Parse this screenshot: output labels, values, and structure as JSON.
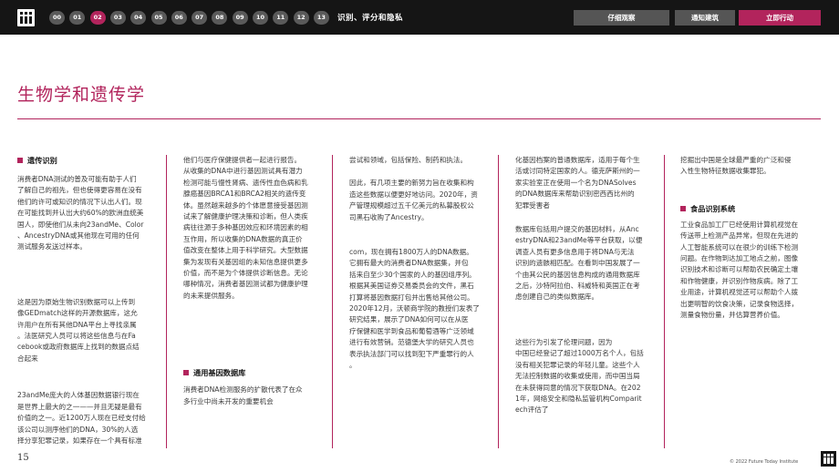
{
  "header": {
    "chapters": [
      "00",
      "01",
      "02",
      "03",
      "04",
      "05",
      "06",
      "07",
      "08",
      "09",
      "10",
      "11",
      "12",
      "13"
    ],
    "active_chapter": "02",
    "section_label": "识别、评分和隐私",
    "tabs": {
      "observe": "仔细观察",
      "notice": "通知建筑",
      "act": "立即行动"
    },
    "accent_color": "#b2245c"
  },
  "title": "生物学和遗传学",
  "col1": {
    "heading": "遗传识别",
    "p1": [
      "消费者DNA测试的普及可能有助于人们",
      "了解自己的祖先，但也使得更容易在没有",
      "他们的许可或知识的情况下认出人们。现",
      "在可能找到并认出大约60%的欧洲血统美",
      "国人，即使他们从未向23andMe、Color",
      "、AncestryDNA或其他现在可用的任何",
      "测试服务发送过样本。"
    ],
    "p2": [
      "这是因为原始生物识别数据可以上传到",
      "像GEDmatch这样的开源数据库，这允",
      "许用户在所有其他DNA平台上寻找亲属",
      "。法医研究人员可以将这些信息与在Fa",
      "cebook或政府数据库上找到的数据点结",
      "合起来"
    ],
    "p3": [
      "23andMe庞大的人体基因数据银行现在",
      "是世界上最大的之一——并且无疑是最有",
      "价值的之一。近1200万人现在已经支付给",
      "该公司以测序他们的DNA，30%的人选",
      "择分享犯罪记录，如果存在一个具有标准"
    ]
  },
  "col2": {
    "p1": [
      "他们与医疗保健提供者一起进行报告。",
      "从收集的DNA中进行基因测试具有潜力",
      "检测可能与慢性肾病、遗传性血色病和乳",
      "腺癌基因BRCA1和BRCA2相关的遗传变",
      "体。虽然越来越多的个体愿意接受基因测",
      "试来了解健康护理决策和诊断，但人类疾",
      "病往往源于多种基因效应和环境因素的相",
      "互作用，所以收集的DNA数据的真正价",
      "值改变在整体上用于科学研究。大型数据",
      "集为发现有关基因组的未知信息提供更多",
      "价值，而不是为个体提供诊断信息。无论",
      "哪种情况，消费者基因测试都为健康护理",
      "的未来提供服务。"
    ],
    "heading": "通用基因数据库",
    "p2": [
      "消费者DNA检测服务的扩散代表了在众",
      "多行业中尚未开发的重要机会"
    ]
  },
  "col3": {
    "p1": [
      "尝试和领域，包括保险、制药和执法。"
    ],
    "p2": [
      "因此，有几项主要的新努力旨在收集和构",
      "造这些数据以便更好地访问。2020年，资",
      "产管理规模超过五千亿美元的私募股权公",
      "司黑石收购了Ancestry。"
    ],
    "p3": [
      "com，现在拥有1800万人的DNA数据。",
      "它拥有最大的消费者DNA数据集，并包",
      "括来自至少30个国家的人的基因组序列。",
      "根据其美国证券交易委员会的文件，黑石",
      "打算将基因数据打包并出售给其他公司。",
      "2020年12月，沃顿商学院的教授们发表了",
      "研究结果，展示了DNA如何可以在从医",
      "疗保健和医学到食品和葡萄酒等广泛领域",
      "进行有效营销。范德堡大学的研究人员也",
      "表示执法部门可以找到犯下严重罪行的人",
      "。"
    ]
  },
  "col4": {
    "p1": [
      "化基因档案的普通数据库，适用于每个生",
      "活或讨同特定国家的人。德克萨斯州的一",
      "家实验室正在使用一个名为DNASolves",
      "的DNA数据库来帮助识别密西西比州的",
      "犯罪受害者"
    ],
    "p2": [
      "数据库包括用户提交的基因材料，从Anc",
      "estryDNA和23andMe等平台获取，以便",
      "调查人员有更多信息用于将DNA与无法",
      "识别的遗骸相匹配。在看到中国发展了一",
      "个由其公民的基因信息构成的通用数据库",
      "之后，沙特阿拉伯、科威特和英国正在考",
      "虑创建自己的类似数据库。"
    ],
    "p3": [
      "这些行为引发了伦理问题，因为",
      "中国已经登记了超过1000万名个人，包括",
      "没有相关犯罪记录的年轻儿童。这些个人",
      "无法控制数据的收集或使用，而中国当局",
      "在未获得同意的情况下获取DNA。在202",
      "1年，网络安全和隐私监管机构Comparit",
      "ech评估了"
    ]
  },
  "col5": {
    "p1": [
      "挖掘出中国是全球最严重的广泛和侵",
      "入性生物特征数据收集罪犯。"
    ],
    "heading": "食品识别系统",
    "p2": [
      "工业食品加工厂已经使用计算机视觉在",
      "传送带上检测产品异常，但现在先进的",
      "人工智能系统可以在很少的训练下检测",
      "问题。在作物到达加工地点之前，图像",
      "识别技术和诊断可以帮助农民确定土壤",
      "和作物健康，并识别作物疾病。除了工",
      "业用途，计算机视觉还可以帮助个人拨",
      "出更明智的饮食决策，记录食物选择，",
      "测量食物份量，并估算营养价值。"
    ]
  },
  "footer": {
    "page_number": "15",
    "copyright": "© 2022 Future Today Institute"
  }
}
